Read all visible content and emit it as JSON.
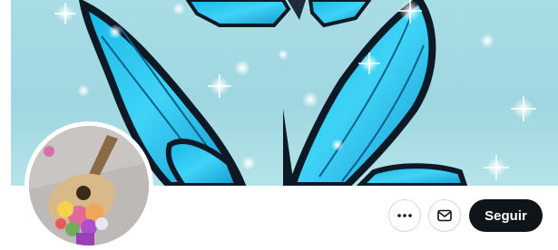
{
  "profile": {
    "banner_icon": "blue-morpho-butterfly-banner",
    "avatar_icon": "guitar-with-flowers-avatar"
  },
  "actions": {
    "more_icon": "more-horizontal-icon",
    "message_icon": "envelope-icon",
    "follow_label": "Seguir"
  },
  "colors": {
    "follow_bg": "#0f1419",
    "follow_text": "#ffffff",
    "button_border": "#cfd9de",
    "banner_sky": "#a9dde6",
    "wing_blue": "#2ec6ee"
  }
}
